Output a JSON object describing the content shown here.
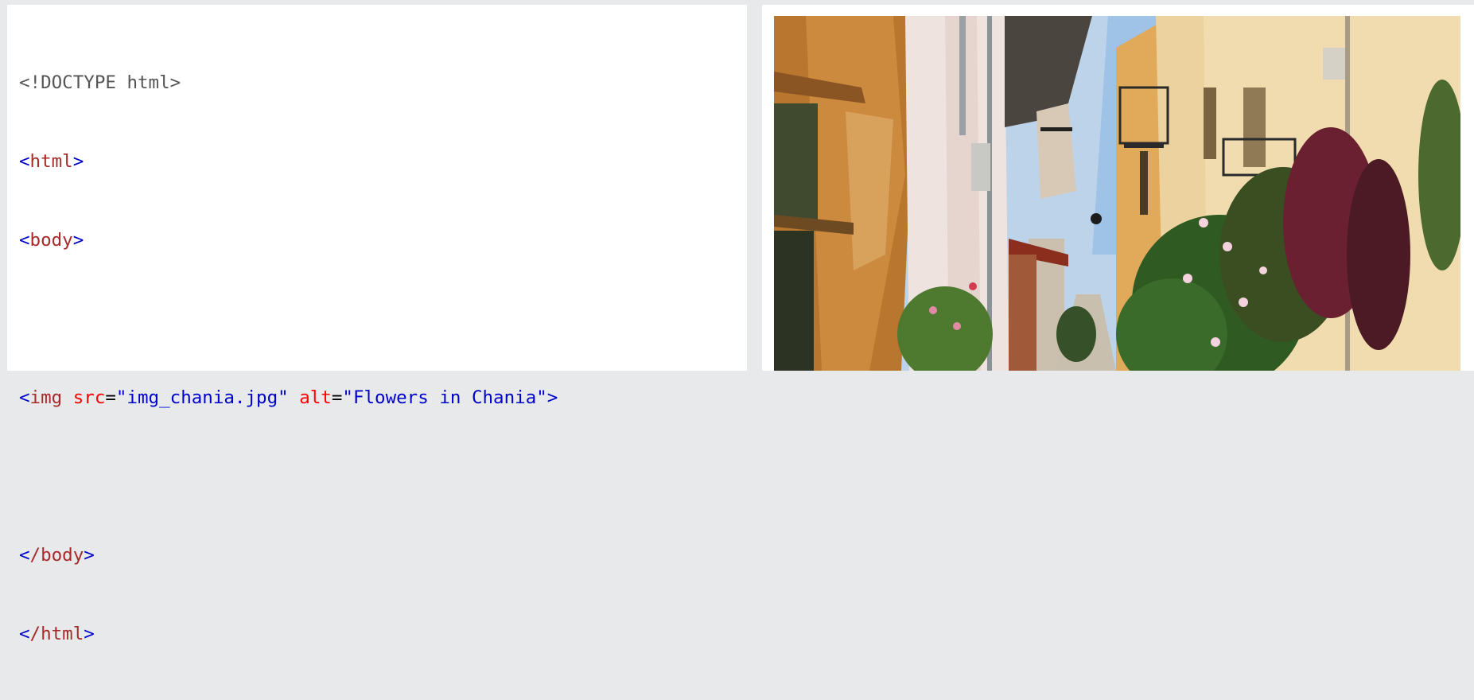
{
  "editor": {
    "doctype": "<!DOCTYPE html>",
    "html_open": "html",
    "body_open": "body",
    "img_tag": "img",
    "src_attr": "src",
    "src_value": "\"img_chania.jpg\"",
    "alt_attr": "alt",
    "alt_value": "\"Flowers in Chania\"",
    "body_close": "/body",
    "html_close": "/html"
  },
  "result": {
    "image_alt": "Flowers in Chania",
    "image_src": "img_chania.jpg"
  },
  "colors": {
    "tag": "#a52a2a",
    "attribute": "#ff0000",
    "value": "#0000cd",
    "background": "#e7e9eb"
  }
}
